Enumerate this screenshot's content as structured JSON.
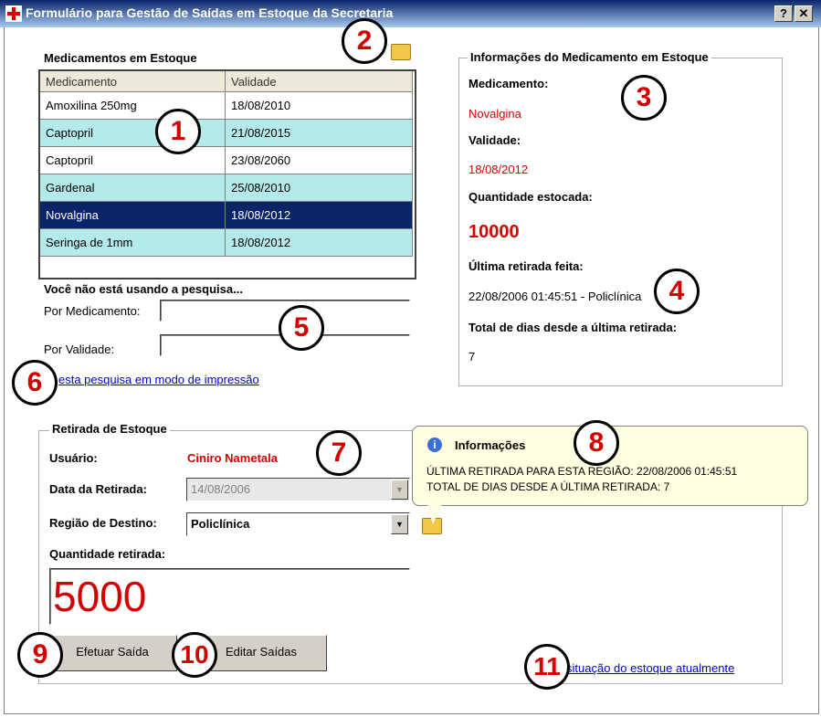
{
  "window": {
    "title": "Formulário para Gestão de Saídas em Estoque da Secretaria",
    "help_btn": "?",
    "close_btn": "✕"
  },
  "stock_list": {
    "heading": "Medicamentos em Estoque",
    "columns": [
      "Medicamento",
      "Validade"
    ],
    "rows": [
      {
        "name": "Amoxilina 250mg",
        "date": "18/08/2010"
      },
      {
        "name": "Captopril",
        "date": "21/08/2015"
      },
      {
        "name": "Captopril",
        "date": "23/08/2060"
      },
      {
        "name": "Gardenal",
        "date": "25/08/2010"
      },
      {
        "name": "Novalgina",
        "date": "18/08/2012"
      },
      {
        "name": "Seringa de 1mm",
        "date": "18/08/2012"
      }
    ],
    "selected_row": 4
  },
  "search": {
    "status": "Você não está usando a pesquisa...",
    "by_medicine_label": "Por Medicamento:",
    "by_medicine_value": "",
    "by_validity_label": "Por Validade:",
    "by_validity_value": "",
    "print_link": "esta pesquisa em modo de impressão"
  },
  "info": {
    "legend": "Informações do Medicamento em Estoque",
    "medicine_label": "Medicamento:",
    "medicine_value": "Novalgina",
    "validity_label": "Validade:",
    "validity_value": "18/08/2012",
    "qty_label": "Quantidade estocada:",
    "qty_value": "10000",
    "last_label": "Última retirada feita:",
    "last_value": "22/08/2006 01:45:51 - Policlínica",
    "days_label": "Total de dias desde a última retirada:",
    "days_value": "7"
  },
  "withdraw": {
    "legend": "Retirada de Estoque",
    "user_label": "Usuário:",
    "user_value": "Ciniro Nametala",
    "date_label": "Data da Retirada:",
    "date_value": "14/08/2006",
    "region_label": "Região de Destino:",
    "region_value": "Policlínica",
    "qty_label": "Quantidade retirada:",
    "qty_value": "5000",
    "save_button": "Efetuar Saída",
    "edit_button": "Editar Saídas",
    "stock_link": "situação do estoque atualmente"
  },
  "tooltip": {
    "title": "Informações",
    "line1": "ÚLTIMA RETIRADA PARA ESTA REGIÃO: 22/08/2006 01:45:51",
    "line2": "TOTAL DE DIAS DESDE A ÚLTIMA RETIRADA: 7"
  },
  "markers": [
    "1",
    "2",
    "3",
    "4",
    "5",
    "6",
    "7",
    "8",
    "9",
    "10",
    "11"
  ],
  "colors": {
    "accent_red": "#d40000",
    "row_alt": "#b5eaea",
    "row_selected": "#0a246a",
    "link": "#0000cc"
  },
  "icons": [
    "app-cross-icon",
    "print-folder-icon",
    "info-icon",
    "region-folder-icon"
  ]
}
